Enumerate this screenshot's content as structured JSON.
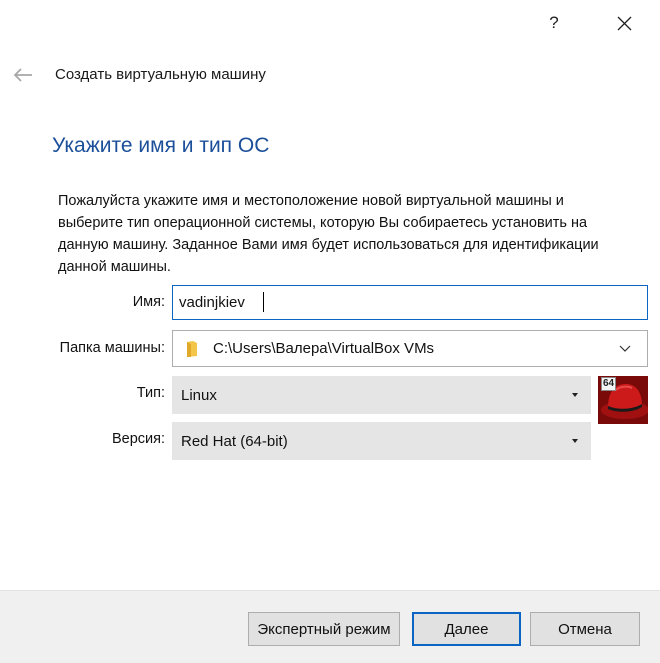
{
  "titlebar": {
    "help_label": "?"
  },
  "wizard": {
    "title": "Создать виртуальную машину",
    "heading": "Укажите имя и тип ОС",
    "description": "Пожалуйста укажите имя и местоположение новой виртуальной машины и выберите тип операционной системы, которую Вы собираетесь установить на данную машину. Заданное Вами имя будет использоваться для идентификации данной машины."
  },
  "form": {
    "name_label": "Имя:",
    "name_value": "vadinjkiev",
    "folder_label": "Папка машины:",
    "folder_value": "C:\\Users\\Валера\\VirtualBox VMs",
    "type_label": "Тип:",
    "type_value": "Linux",
    "version_label": "Версия:",
    "version_value": "Red Hat (64-bit)",
    "os_badge": "64"
  },
  "buttons": {
    "expert": "Экспертный режим",
    "next": "Далее",
    "cancel": "Отмена"
  },
  "icons": {
    "help": "help-icon",
    "close": "close-icon",
    "back": "back-arrow-icon",
    "folder": "folder-icon",
    "chevron": "chevron-down-icon",
    "os": "redhat-os-icon"
  },
  "colors": {
    "heading": "#1b4f9a",
    "focus_border": "#0a66c2",
    "select_bg": "#e5e5e5",
    "footer_bg": "#f0f0f0",
    "folder_yellow": "#f3c64a",
    "redhat_red": "#cc1a1a"
  }
}
